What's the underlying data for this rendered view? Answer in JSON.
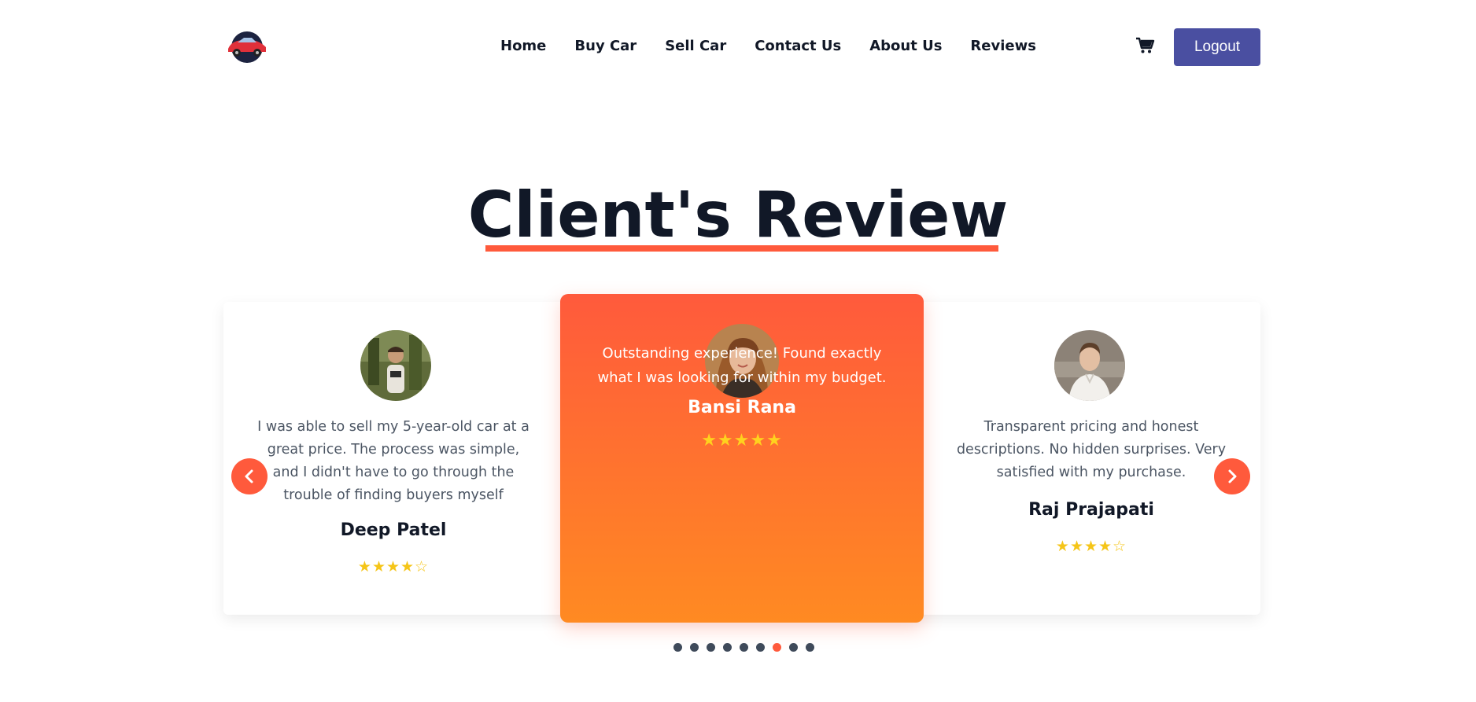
{
  "navbar": {
    "links": [
      "Home",
      "Buy Car",
      "Sell Car",
      "Contact Us",
      "About Us",
      "Reviews"
    ],
    "logout_label": "Logout"
  },
  "section": {
    "title": "Client's Review"
  },
  "reviews": [
    {
      "text": "I was able to sell my 5-year-old car at a great price. The process was simple, and I didn't have to go through the trouble of finding buyers myself",
      "name": "Deep Patel",
      "stars": "★★★★☆",
      "rating": 4
    },
    {
      "text": "Outstanding experience! Found exactly what I was looking for within my budget.",
      "name": "Bansi Rana",
      "stars": "★★★★★",
      "rating": 5
    },
    {
      "text": "Transparent pricing and honest descriptions. No hidden surprises. Very satisfied with my purchase.",
      "name": "Raj Prajapati",
      "stars": "★★★★☆",
      "rating": 4
    }
  ],
  "carousel": {
    "dot_count": 9,
    "active_dot": 6
  },
  "colors": {
    "accent": "#ff5a3c",
    "accent_gradient_end": "#ff8a22",
    "button": "#4a4fa1",
    "dot": "#3f4a5a",
    "star": "#f5c518"
  },
  "icons": [
    "car-logo-icon",
    "cart-icon",
    "chevron-left-icon",
    "chevron-right-icon"
  ]
}
